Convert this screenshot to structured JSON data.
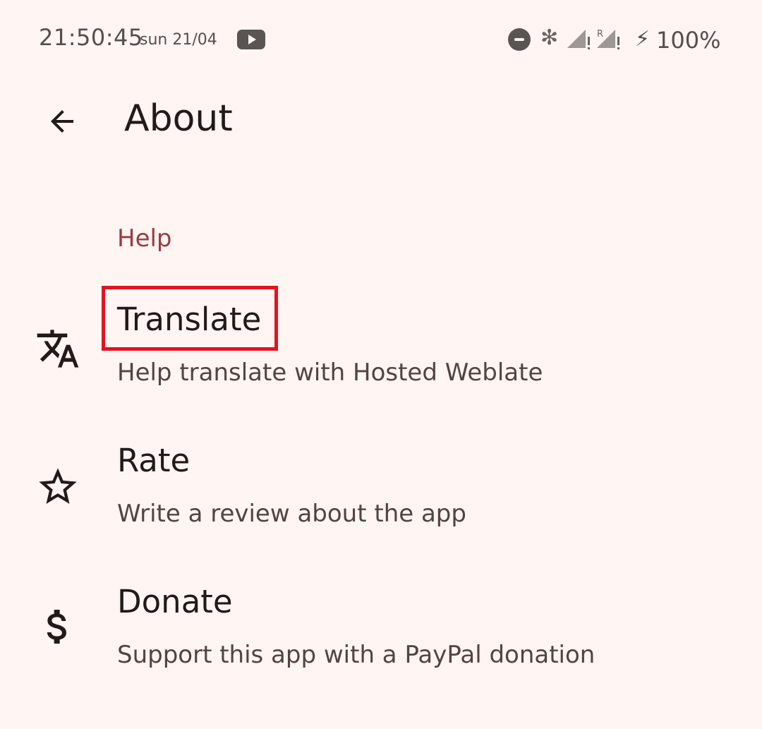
{
  "status_bar": {
    "time": "21:50:45",
    "date": "sun 21/04",
    "battery": "100%",
    "icons": [
      "youtube-icon",
      "do-not-disturb-icon",
      "cannabis-leaf-icon",
      "signal-icon",
      "signal-roaming-icon",
      "charging-bolt-icon"
    ]
  },
  "app_bar": {
    "title": "About",
    "back_icon": "arrow-back-icon"
  },
  "section": {
    "header": "Help",
    "header_color": "#9a3c40"
  },
  "items": [
    {
      "title": "Translate",
      "summary": "Help translate with Hosted Weblate",
      "icon": "translate-icon"
    },
    {
      "title": "Rate",
      "summary": "Write a review about the app",
      "icon": "star-outline-icon"
    },
    {
      "title": "Donate",
      "summary": "Support this app with a PayPal donation",
      "icon": "dollar-icon"
    }
  ],
  "colors": {
    "background": "#fff5f3",
    "highlight": "#e3131f"
  }
}
